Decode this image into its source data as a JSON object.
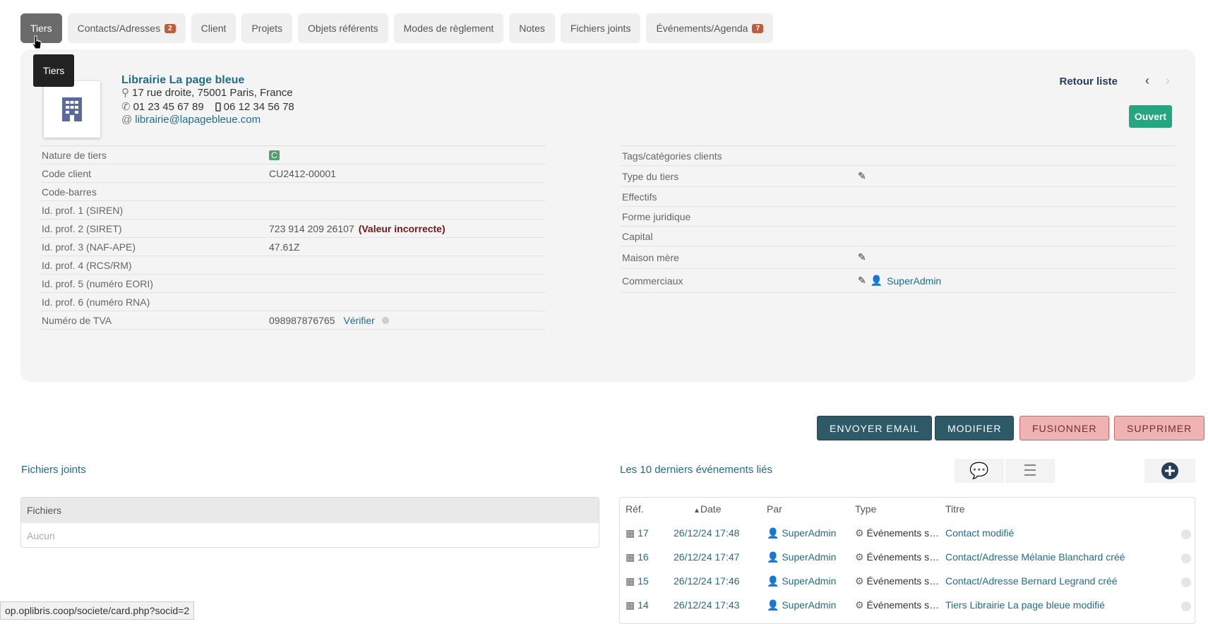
{
  "tabs": [
    {
      "label": "Tiers",
      "active": true
    },
    {
      "label": "Contacts/Adresses",
      "badge": "2"
    },
    {
      "label": "Client"
    },
    {
      "label": "Projets"
    },
    {
      "label": "Objets référents"
    },
    {
      "label": "Modes de règlement"
    },
    {
      "label": "Notes"
    },
    {
      "label": "Fichiers joints"
    },
    {
      "label": "Événements/Agenda",
      "badge": "7"
    }
  ],
  "tooltip": "Tiers",
  "company": {
    "name": "Librairie La page bleue",
    "address": "17 rue droite, 75001 Paris, France",
    "phone": "01 23 45 67 89",
    "mobile": "06 12 34 56 78",
    "email": "librairie@lapagebleue.com",
    "status": "Ouvert"
  },
  "nav": {
    "back_label": "Retour liste"
  },
  "left_fields": [
    {
      "label": "Nature de tiers",
      "value": "C"
    },
    {
      "label": "Code client",
      "value": "CU2412-00001"
    },
    {
      "label": "Code-barres",
      "value": ""
    },
    {
      "label": "Id. prof. 1 (SIREN)",
      "value": ""
    },
    {
      "label": "Id. prof. 2 (SIRET)",
      "value": "723 914 209 26107",
      "error": "(Valeur incorrecte)"
    },
    {
      "label": "Id. prof. 3 (NAF-APE)",
      "value": "47.61Z"
    },
    {
      "label": "Id. prof. 4 (RCS/RM)",
      "value": ""
    },
    {
      "label": "Id. prof. 5 (numéro EORI)",
      "value": ""
    },
    {
      "label": "Id. prof. 6 (numéro RNA)",
      "value": ""
    },
    {
      "label": "Numéro de TVA",
      "value": "098987876765",
      "action": "Vérifier"
    }
  ],
  "right_fields": [
    {
      "label": "Tags/catégories clients"
    },
    {
      "label": "Type du tiers"
    },
    {
      "label": "Effectifs"
    },
    {
      "label": "Forme juridique"
    },
    {
      "label": "Capital"
    },
    {
      "label": "Maison mère"
    },
    {
      "label": "Commerciaux",
      "value": "SuperAdmin"
    }
  ],
  "buttons": {
    "email": "ENVOYER EMAIL",
    "modify": "MODIFIER",
    "merge": "FUSIONNER",
    "delete": "SUPPRIMER"
  },
  "files": {
    "title": "Fichiers joints",
    "header": "Fichiers",
    "empty": "Aucun"
  },
  "events": {
    "title": "Les 10 derniers événements liés",
    "columns": {
      "ref": "Réf.",
      "date": "Date",
      "by": "Par",
      "type": "Type",
      "title": "Titre"
    },
    "rows": [
      {
        "ref": "17",
        "date": "26/12/24 17:48",
        "by": "SuperAdmin",
        "type": "Événements système",
        "title": "Contact modifié"
      },
      {
        "ref": "16",
        "date": "26/12/24 17:47",
        "by": "SuperAdmin",
        "type": "Événements système",
        "title": "Contact/Adresse Mélanie Blanchard créé"
      },
      {
        "ref": "15",
        "date": "26/12/24 17:46",
        "by": "SuperAdmin",
        "type": "Événements système",
        "title": "Contact/Adresse Bernard Legrand créé"
      },
      {
        "ref": "14",
        "date": "26/12/24 17:43",
        "by": "SuperAdmin",
        "type": "Événements système",
        "title": "Tiers Librairie La page bleue modifié"
      }
    ]
  },
  "status_url": "op.oplibris.coop/societe/card.php?socid=2",
  "colors": {
    "accent": "#1e6d8a",
    "status_open": "#25a580",
    "danger_bg": "#efb3b3"
  }
}
